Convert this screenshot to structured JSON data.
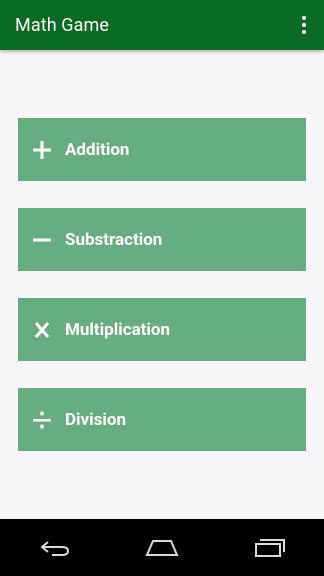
{
  "app": {
    "title": "Math Game",
    "colors": {
      "app_bar": "#0b6a23",
      "button": "#66ad81",
      "background": "#f7f7f9"
    }
  },
  "menu": {
    "icon": "overflow-menu-icon"
  },
  "operations": [
    {
      "label": "Addition",
      "icon": "plus-icon"
    },
    {
      "label": "Substraction",
      "icon": "minus-icon"
    },
    {
      "label": "Multiplication",
      "icon": "multiply-icon"
    },
    {
      "label": "Division",
      "icon": "divide-icon"
    }
  ],
  "system_nav": {
    "buttons": [
      "back-icon",
      "home-icon",
      "recent-apps-icon"
    ]
  }
}
